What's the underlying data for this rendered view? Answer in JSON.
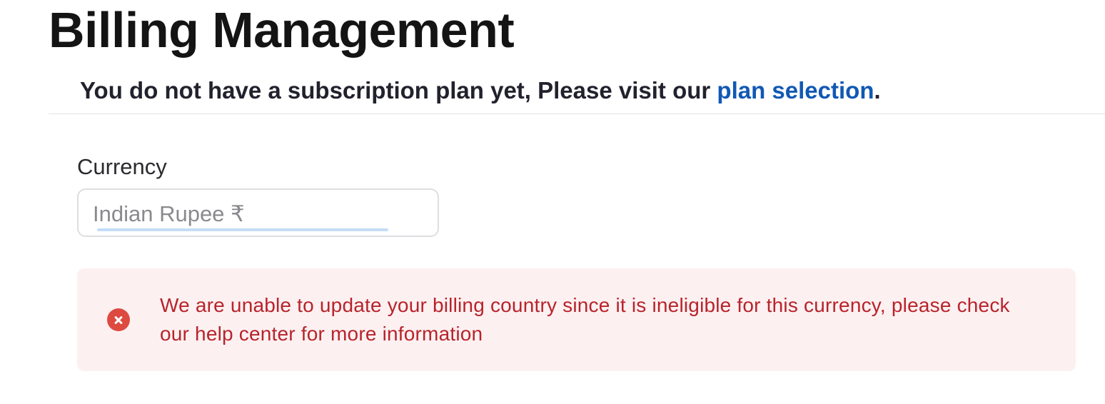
{
  "page": {
    "title": "Billing Management"
  },
  "subscription_notice": {
    "text": "You do not have a subscription plan yet, Please visit our ",
    "link_text": "plan selection",
    "suffix": "."
  },
  "currency": {
    "label": "Currency",
    "selected_value": "Indian Rupee ₹"
  },
  "error_alert": {
    "icon": "error-x-circle-icon",
    "message": "We are unable to update your billing country since it is ineligible for this currency, please check our help center for more information"
  },
  "colors": {
    "link": "#1158b4",
    "error_text": "#b7242b",
    "error_icon": "#dd4a40",
    "error_background": "#fdf0f1"
  }
}
